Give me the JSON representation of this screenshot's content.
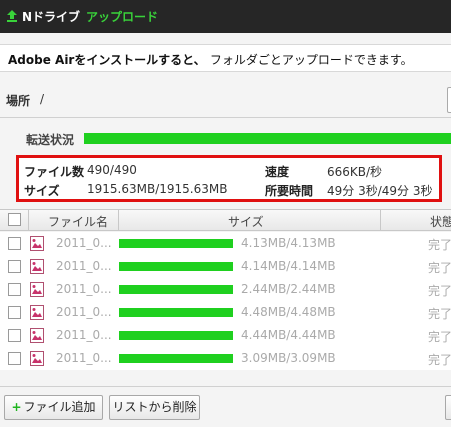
{
  "titlebar": {
    "app_title": "Nドライブ",
    "upload_tab": "アップロード"
  },
  "notice": {
    "bold_text": "Adobe Airをインストールすると、",
    "normal_text": "フォルダごとアップロードできます。"
  },
  "location": {
    "label": "場所",
    "value": "/"
  },
  "transfer": {
    "label": "転送状況",
    "progress": 1.0
  },
  "stats": {
    "file_count_label": "ファイル数",
    "file_count_value": "490/490",
    "size_label": "サイズ",
    "size_value": "1915.63MB/1915.63MB",
    "speed_label": "速度",
    "speed_value": "666KB/秒",
    "time_label": "所要時間",
    "time_value": "49分 3秒/49分 3秒"
  },
  "table": {
    "columns": {
      "filename": "ファイル名",
      "size": "サイズ",
      "status": "状態"
    },
    "rows": [
      {
        "name": "2011_0...",
        "size": "4.13MB/4.13MB",
        "status": "完了",
        "progress": 1.0
      },
      {
        "name": "2011_0...",
        "size": "4.14MB/4.14MB",
        "status": "完了",
        "progress": 1.0
      },
      {
        "name": "2011_0...",
        "size": "2.44MB/2.44MB",
        "status": "完了",
        "progress": 1.0
      },
      {
        "name": "2011_0...",
        "size": "4.48MB/4.48MB",
        "status": "完了",
        "progress": 1.0
      },
      {
        "name": "2011_0...",
        "size": "4.44MB/4.44MB",
        "status": "完了",
        "progress": 1.0
      },
      {
        "name": "2011_0...",
        "size": "3.09MB/3.09MB",
        "status": "完了",
        "progress": 1.0
      }
    ]
  },
  "footer": {
    "add_file_label": "ファイル追加",
    "add_icon": "plus-icon",
    "remove_list_label": "リストから削除"
  },
  "colors": {
    "progress_green": "#1fd01f",
    "tab_green": "#39d23a",
    "highlight_red": "#e01010",
    "titlebar_bg": "#262626"
  }
}
